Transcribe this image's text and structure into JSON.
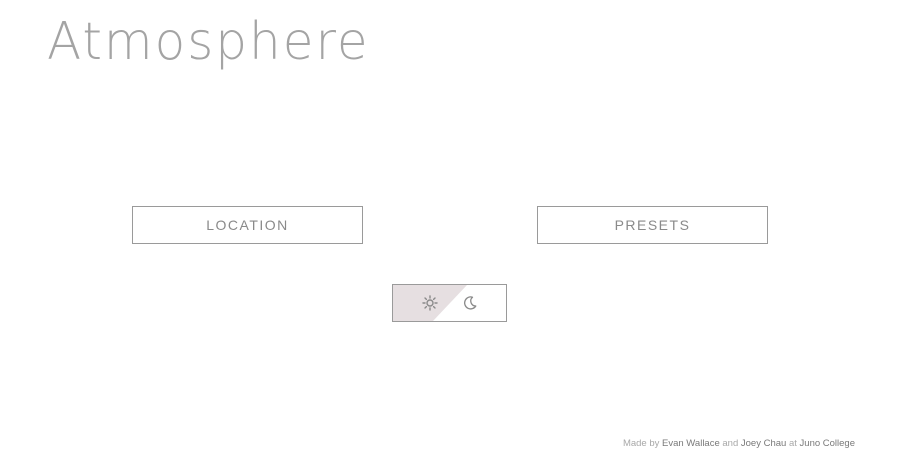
{
  "app": {
    "title": "Atmosphere"
  },
  "nav": {
    "location_label": "LOCATION",
    "presets_label": "PRESETS"
  },
  "theme_toggle": {
    "light_icon": "sun-icon",
    "dark_icon": "moon-icon",
    "active": "light"
  },
  "footer": {
    "made_by": "Made by",
    "author1": "Evan Wallace",
    "and": "and",
    "author2": "Joey Chau",
    "at": "at",
    "school": "Juno College"
  },
  "colors": {
    "title": "#a4a4a4",
    "border": "#9a9a9a",
    "button_text": "#8a8a8a",
    "toggle_active_bg": "#e6dfe1",
    "icon": "#8a8a8a",
    "footer_text": "#a8a8a8",
    "footer_link": "#7a7a7a"
  }
}
